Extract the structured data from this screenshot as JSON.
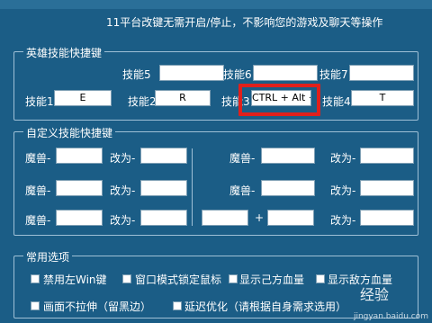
{
  "notice": "11平台改键无需开启/停止，不影响您的游戏及聊天等操作",
  "hero": {
    "legend": "英雄技能快捷键",
    "skills": [
      {
        "label": "技能5",
        "value": ""
      },
      {
        "label": "技能6",
        "value": ""
      },
      {
        "label": "技能7",
        "value": ""
      },
      {
        "label": "技能1",
        "value": "E"
      },
      {
        "label": "技能2",
        "value": "R"
      },
      {
        "label": "技能3",
        "value": "CTRL + Alt +"
      },
      {
        "label": "技能4",
        "value": "T"
      }
    ]
  },
  "custom": {
    "legend": "自定义技能快捷键",
    "warcraft_label": "魔兽-",
    "change_label": "改为-",
    "plus": "+"
  },
  "options": {
    "legend": "常用选项",
    "items": [
      {
        "label": "禁用左Win键"
      },
      {
        "label": "窗口模式锁定鼠标"
      },
      {
        "label": "显示己方血量"
      },
      {
        "label": "显示敌方血量"
      },
      {
        "label": "画面不拉伸（留黑边）"
      },
      {
        "label": "延迟优化（请根据自身需求选用）"
      }
    ]
  },
  "watermark": {
    "brand": "经验",
    "url": "jingyan.baidu.com"
  },
  "colors": {
    "background": "#1b5d86",
    "highlight": "#e0201c"
  }
}
